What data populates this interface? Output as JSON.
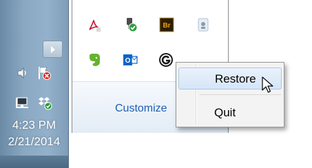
{
  "tray": {
    "icons": [
      {
        "name": "speaker-icon"
      },
      {
        "name": "action-center-flag-icon"
      },
      {
        "name": "network-icon"
      },
      {
        "name": "dropbox-icon"
      }
    ],
    "clock": {
      "time": "4:23 PM",
      "date": "2/21/2014"
    }
  },
  "overflow": {
    "icons": [
      {
        "name": "acrobat-icon",
        "color": "#c8102e"
      },
      {
        "name": "safely-remove-hardware-icon",
        "color": "#3a3a3a"
      },
      {
        "name": "bridge-icon",
        "color": "#2d1d00"
      },
      {
        "name": "unknown-app-icon",
        "color": "#8a9bb0"
      },
      {
        "name": "evernote-icon",
        "color": "#64b32e"
      },
      {
        "name": "outlook-icon",
        "color": "#0a64c8"
      },
      {
        "name": "g-app-icon",
        "color": "#1a1a1a"
      }
    ],
    "bridge_label": "Br",
    "outlook_label": "O",
    "customize_label": "Customize"
  },
  "context_menu": {
    "items": [
      {
        "label": "Restore"
      },
      {
        "label": "Quit"
      }
    ]
  },
  "colors": {
    "taskbar": "#8aa8c2",
    "link": "#1e5eb0",
    "menu_hover_border": "#a8c8ec"
  }
}
